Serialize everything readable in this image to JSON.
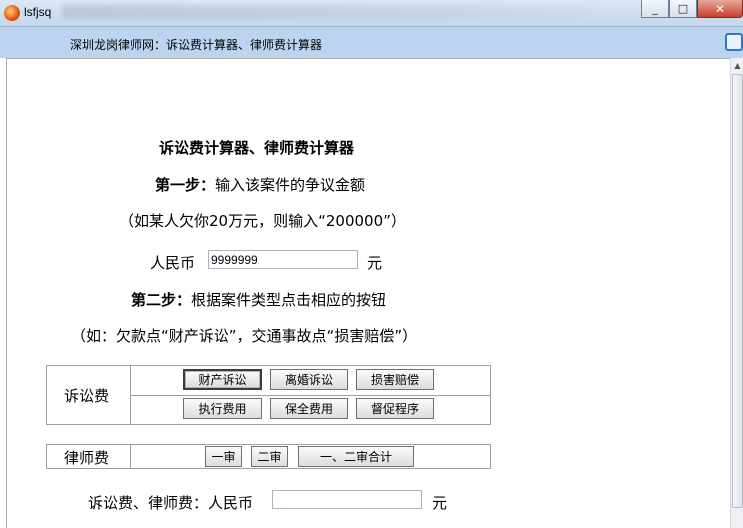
{
  "window": {
    "title": "lsfjsq",
    "minimize": "_",
    "maximize": "□",
    "close": "✕"
  },
  "banner": {
    "text": "深圳龙岗律师网：诉讼费计算器、律师费计算器"
  },
  "main": {
    "heading": "诉讼费计算器、律师费计算器",
    "step1_label": "第一步：",
    "step1_text": "输入该案件的争议金额",
    "step1_hint": "（如某人欠你20万元，则输入“200000”）",
    "currency_label": "人民币",
    "amount_value": "9999999",
    "unit": "元",
    "step2_label": "第二步：",
    "step2_text": "根据案件类型点击相应的按钮",
    "step2_hint": "（如：欠款点“财产诉讼”，交通事故点“损害赔偿”）"
  },
  "litigation": {
    "label": "诉讼费",
    "buttons": [
      "财产诉讼",
      "离婚诉讼",
      "损害赔偿",
      "执行费用",
      "保全费用",
      "督促程序"
    ]
  },
  "lawyer": {
    "label": "律师费",
    "buttons": [
      "一审",
      "二审",
      "一、二审合计"
    ]
  },
  "result": {
    "label": "诉讼费、律师费：人民币",
    "value": "",
    "unit": "元"
  },
  "colors": {
    "banner": "#bcd4ef",
    "titlebar": "#c5d7ec",
    "close": "#c7402b"
  }
}
